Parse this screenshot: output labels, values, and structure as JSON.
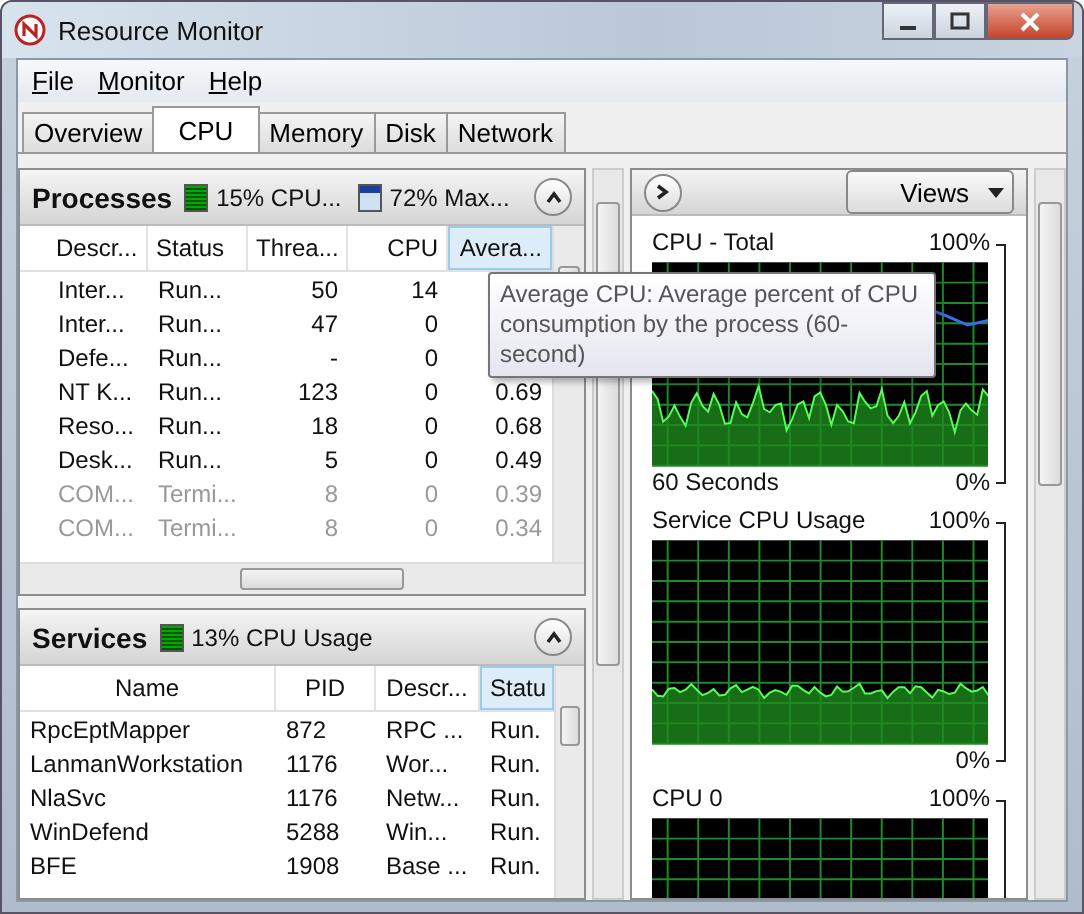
{
  "window": {
    "title": "Resource Monitor"
  },
  "menu": [
    {
      "label": "File"
    },
    {
      "label": "Monitor"
    },
    {
      "label": "Help"
    }
  ],
  "tabs": [
    {
      "label": "Overview",
      "selected": false
    },
    {
      "label": "CPU",
      "selected": true
    },
    {
      "label": "Memory",
      "selected": false
    },
    {
      "label": "Disk",
      "selected": false
    },
    {
      "label": "Network",
      "selected": false
    }
  ],
  "processes": {
    "title": "Processes",
    "cpu_usage": "15% CPU...",
    "max_frequency": "72% Max...",
    "expanded": true,
    "columns": [
      {
        "label": "Descr...",
        "sorted": false
      },
      {
        "label": "Status",
        "sorted": false
      },
      {
        "label": "Threa...",
        "sorted": false
      },
      {
        "label": "CPU",
        "sorted": false
      },
      {
        "label": "Avera...",
        "sorted": true
      }
    ],
    "rows": [
      {
        "cells": [
          "Inter...",
          "Run...",
          "50",
          "14"
        ],
        "terminated": false
      },
      {
        "cells": [
          "Inter...",
          "Run...",
          "47",
          "0"
        ],
        "terminated": false
      },
      {
        "cells": [
          "Defe...",
          "Run...",
          "-",
          "0"
        ],
        "terminated": false
      },
      {
        "cells": [
          "NT K...",
          "Run...",
          "123",
          "0",
          "0.69"
        ],
        "terminated": false
      },
      {
        "cells": [
          "Reso...",
          "Run...",
          "18",
          "0",
          "0.68"
        ],
        "terminated": false
      },
      {
        "cells": [
          "Desk...",
          "Run...",
          "5",
          "0",
          "0.49"
        ],
        "terminated": false
      },
      {
        "cells": [
          "COM...",
          "Termi...",
          "8",
          "0",
          "0.39"
        ],
        "terminated": true
      },
      {
        "cells": [
          "COM...",
          "Termi...",
          "8",
          "0",
          "0.34"
        ],
        "terminated": true
      }
    ]
  },
  "tooltip": {
    "text": "Average CPU: Average percent of CPU consumption by the process (60-second)"
  },
  "services": {
    "title": "Services",
    "cpu_usage": "13% CPU Usage",
    "expanded": true,
    "columns": [
      {
        "label": "Name",
        "sorted": false
      },
      {
        "label": "PID",
        "sorted": false
      },
      {
        "label": "Descr...",
        "sorted": false
      },
      {
        "label": "Statu",
        "sorted": true
      }
    ],
    "rows": [
      {
        "cells": [
          "RpcEptMapper",
          "872",
          "RPC ...",
          "Run."
        ]
      },
      {
        "cells": [
          "LanmanWorkstation",
          "1176",
          "Wor...",
          "Run."
        ]
      },
      {
        "cells": [
          "NlaSvc",
          "1176",
          "Netw...",
          "Run."
        ]
      },
      {
        "cells": [
          "WinDefend",
          "5288",
          "Win...",
          "Run."
        ]
      },
      {
        "cells": [
          "BFE",
          "1908",
          "Base ...",
          "Run."
        ]
      }
    ]
  },
  "monitor": {
    "views_label": "Views",
    "graphs": [
      {
        "title": "CPU - Total",
        "max": "100%",
        "min": "0%",
        "footer": "60 Seconds"
      },
      {
        "title": "Service CPU Usage",
        "max": "100%",
        "min": "0%"
      },
      {
        "title": "CPU 0",
        "max": "100%"
      }
    ]
  }
}
